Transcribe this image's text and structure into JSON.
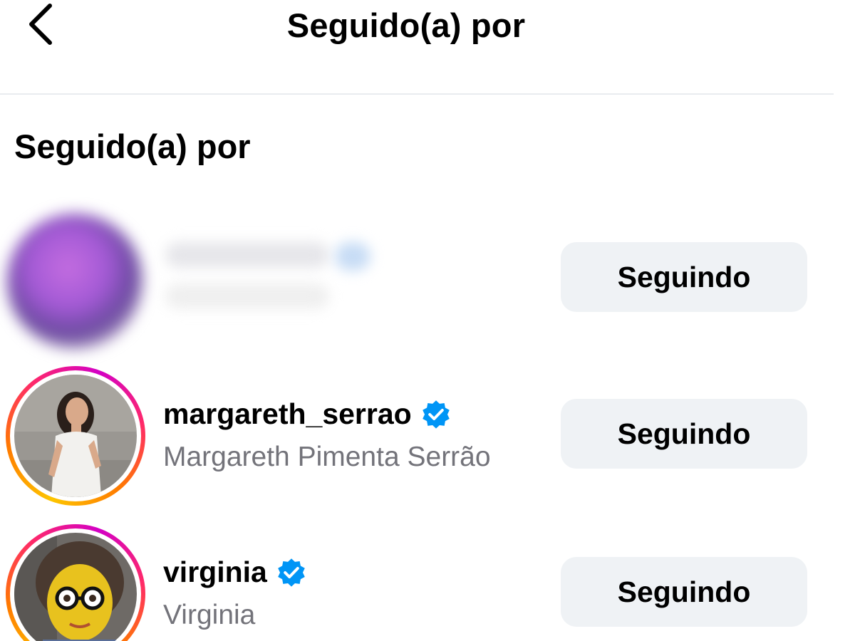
{
  "header": {
    "title": "Seguido(a) por",
    "back_icon": "chevron-left-icon"
  },
  "section": {
    "title": "Seguido(a) por"
  },
  "accounts": [
    {
      "username": "",
      "full_name": "",
      "blurred": true,
      "button_label": "Seguindo"
    },
    {
      "username": "margareth_serrao",
      "full_name": "Margareth Pimenta Serrão",
      "verified": true,
      "has_story_ring": true,
      "button_label": "Seguindo"
    },
    {
      "username": "virginia",
      "full_name": "Virginia",
      "verified": true,
      "has_story_ring": true,
      "button_label": "Seguindo"
    }
  ],
  "colors": {
    "verified_badge": "#0095f6",
    "button_bg": "#eff2f5",
    "secondary_text": "#73737a",
    "divider": "#e9ecef"
  }
}
